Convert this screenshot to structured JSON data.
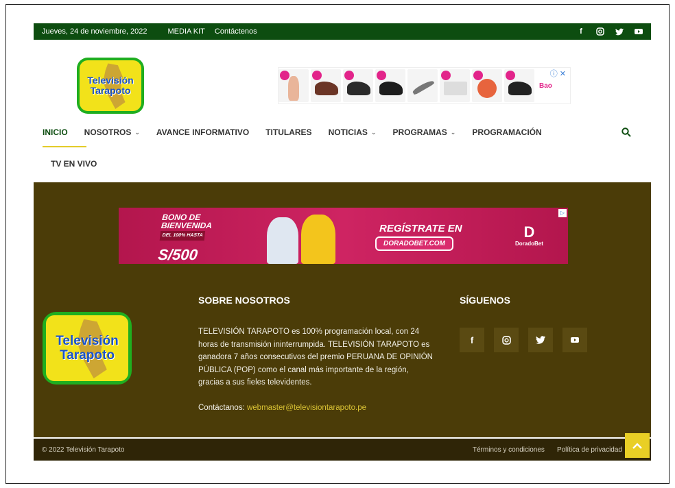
{
  "topbar": {
    "date": "Jueves, 24 de noviembre, 2022",
    "links": [
      "MEDIA KIT",
      "Contáctenos"
    ],
    "social_icons": [
      "facebook-icon",
      "instagram-icon",
      "twitter-icon",
      "youtube-icon"
    ]
  },
  "logo": {
    "line1": "Televisión",
    "line2": "Tarapoto"
  },
  "ad_top": {
    "advertiser": "Bao",
    "close": "ⓘ ✕"
  },
  "nav": {
    "items": [
      {
        "label": "INICIO",
        "dropdown": false
      },
      {
        "label": "NOSOTROS",
        "dropdown": true
      },
      {
        "label": "AVANCE INFORMATIVO",
        "dropdown": false
      },
      {
        "label": "TITULARES",
        "dropdown": false
      },
      {
        "label": "NOTICIAS",
        "dropdown": true
      },
      {
        "label": "PROGRAMAS",
        "dropdown": true
      },
      {
        "label": "PROGRAMACIÓN",
        "dropdown": false
      }
    ],
    "second_row": "TV EN VIVO"
  },
  "banner": {
    "line1": "BONO DE",
    "line2": "BIENVENIDA",
    "sub": "DEL 100% HASTA",
    "amount": "S/500",
    "cta_title": "REGÍSTRATE EN",
    "cta_button": "DORADOBET.COM",
    "brand": "DoradoBet"
  },
  "about": {
    "title": "SOBRE NOSOTROS",
    "text": "TELEVISIÓN TARAPOTO es 100% programación local, con 24 horas de transmisión ininterrumpida. TELEVISIÓN TARAPOTO es ganadora 7 años consecutivos del premio PERUANA DE OPINIÓN PÚBLICA (POP) como el canal más importante de la región, gracias a sus fieles televidentes.",
    "contact_label": "Contáctanos:",
    "contact_email": "webmaster@televisiontarapoto.pe"
  },
  "follow": {
    "title": "SÍGUENOS"
  },
  "footer": {
    "copyright": "© 2022 Televisión Tarapoto",
    "terms": "Términos y condiciones",
    "privacy": "Política de privacidad"
  },
  "colors": {
    "topbar": "#0d4d10",
    "footer_section": "#4b3c08",
    "footer_bottom": "#2f2507",
    "accent": "#e9cf25"
  }
}
